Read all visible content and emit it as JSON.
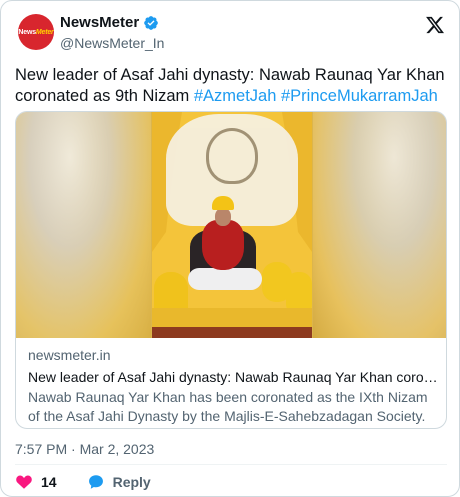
{
  "header": {
    "display_name": "NewsMeter",
    "handle": "@NewsMeter_In",
    "avatar_text_main": "News",
    "avatar_text_accent": "Meter"
  },
  "tweet": {
    "text_main": "New leader of Asaf Jahi dynasty: Nawab Raunaq Yar Khan coronated as 9th Nizam",
    "hashtag_1": "#AzmetJah",
    "hashtag_2": "#PrinceMukarramJah"
  },
  "link_card": {
    "domain": "newsmeter.in",
    "title": "New leader of Asaf Jahi dynasty: Nawab Raunaq Yar Khan coronated as …",
    "description": "Nawab Raunaq Yar Khan has been coronated as the IXth Nizam of the Asaf Jahi Dynasty by the Majlis-E-Sahebzadagan Society."
  },
  "meta": {
    "timestamp": "7:57 PM · Mar 2, 2023"
  },
  "actions": {
    "like_count": "14",
    "reply_label": "Reply"
  },
  "colors": {
    "accent": "#1d9bf0",
    "like": "#f91880",
    "brand_red": "#d8262e"
  }
}
